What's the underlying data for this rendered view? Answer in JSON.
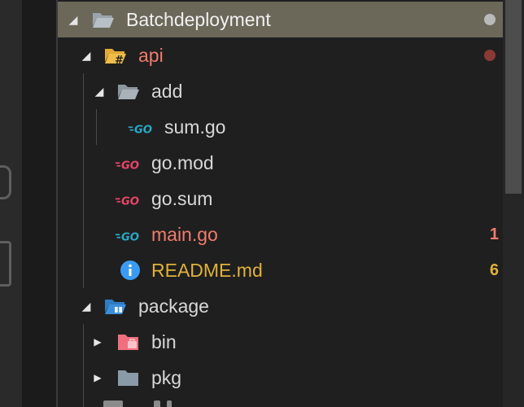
{
  "explorer": {
    "root": {
      "label": "Batchdeployment",
      "icon": "folder-open-icon",
      "expanded": true,
      "status_color": "#b9b9b9"
    },
    "items": [
      {
        "label": "api",
        "icon": "folder-api-icon",
        "expanded": true,
        "status_color": "#8a3a34",
        "label_color": "#f07c6c"
      },
      {
        "label": "add",
        "icon": "folder-open-icon",
        "expanded": true
      },
      {
        "label": "sum.go",
        "icon": "go-file-icon",
        "icon_color": "#29a8c5"
      },
      {
        "label": "go.mod",
        "icon": "go-file-icon",
        "icon_color": "#e8456a"
      },
      {
        "label": "go.sum",
        "icon": "go-file-icon",
        "icon_color": "#e8456a"
      },
      {
        "label": "main.go",
        "icon": "go-file-icon",
        "icon_color": "#29a8c5",
        "label_color": "#f07c6c",
        "badge": "1",
        "badge_color": "#f07c6c"
      },
      {
        "label": "README.md",
        "icon": "info-icon",
        "icon_color": "#3b9bf2",
        "label_color": "#e0b13a",
        "badge": "6",
        "badge_color": "#e0b13a"
      },
      {
        "label": "package",
        "icon": "folder-package-icon",
        "expanded": true,
        "icon_color": "#3a8fd8"
      },
      {
        "label": "bin",
        "icon": "folder-bin-icon",
        "expanded": false,
        "icon_color": "#ef6f7e"
      },
      {
        "label": "pkg",
        "icon": "folder-icon",
        "expanded": false,
        "icon_color": "#8a9aa6"
      }
    ],
    "glyphs": {
      "expanded": "◢",
      "collapsed": "▶"
    }
  },
  "colors": {
    "selected_row": "#6b685a",
    "background": "#1f1f1f",
    "text": "#d8d8d8"
  }
}
